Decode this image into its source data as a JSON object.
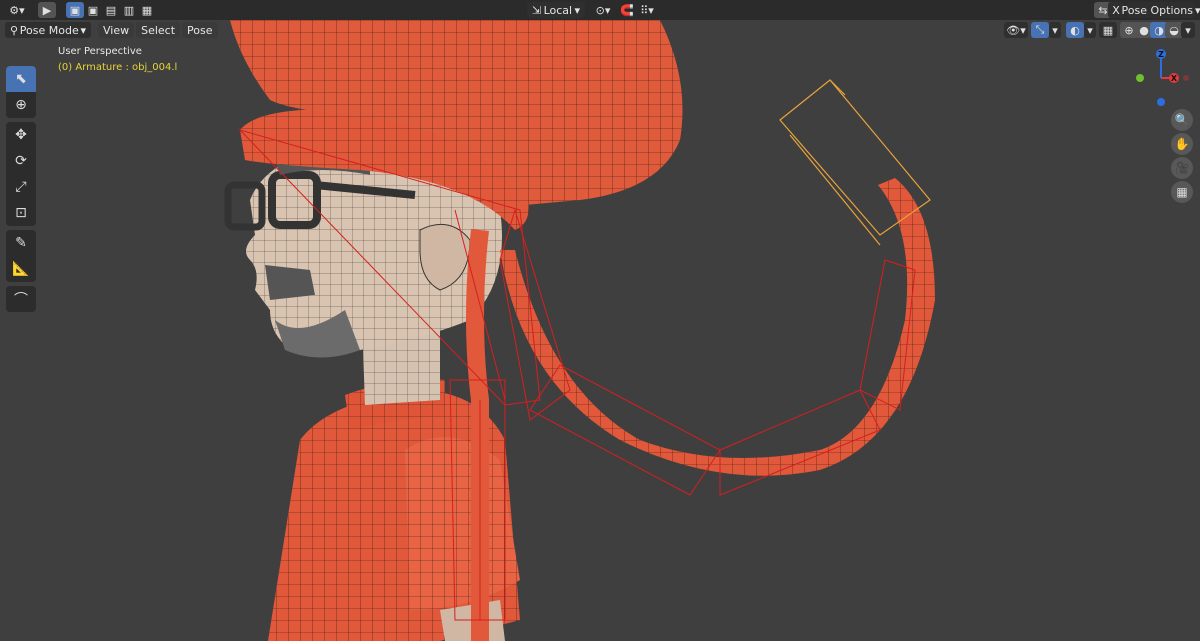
{
  "header": {
    "transform_orientation": "Local",
    "pose_options_label": "Pose Options",
    "x_label": "X"
  },
  "viewport_header": {
    "mode": "Pose Mode",
    "menus": [
      "View",
      "Select",
      "Pose"
    ]
  },
  "overlay": {
    "perspective": "User Perspective",
    "object_info": "(0) Armature : obj_004.l"
  },
  "gizmo": {
    "z": "Z",
    "x": "X"
  },
  "colors": {
    "accent": "#4772b3",
    "object_info": "#e6d337",
    "mesh": "#e2583a"
  }
}
